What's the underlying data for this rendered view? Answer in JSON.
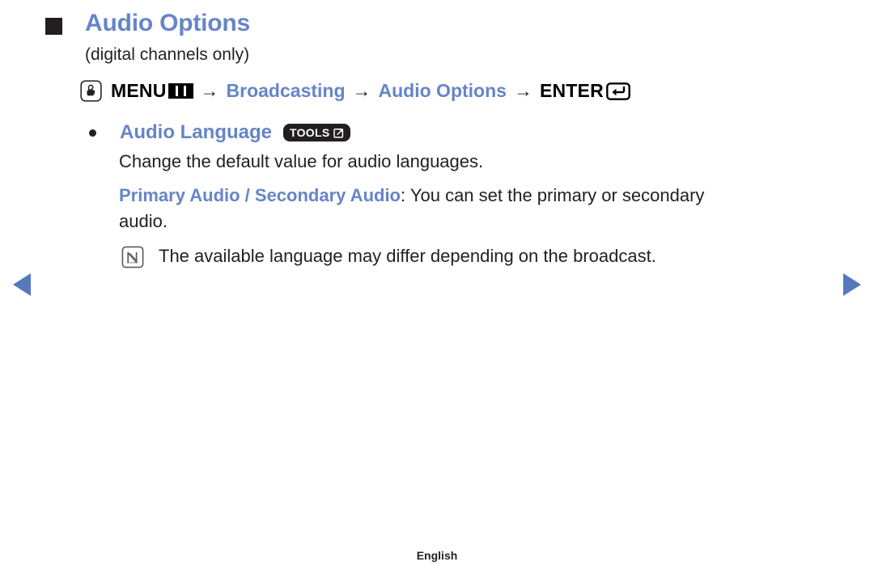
{
  "heading": {
    "bullet_icon": "filled-square-bullet",
    "title": "Audio Options",
    "subtitle": "(digital channels only)"
  },
  "menu_path": {
    "hand_icon": "hand-touch-icon",
    "menu_label": "MENU",
    "menu_glyph_icon": "menu-bars-icon",
    "arrow": "→",
    "step_broadcasting": "Broadcasting",
    "step_audio_options": "Audio Options",
    "enter_label": "ENTER",
    "enter_glyph_icon": "enter-return-key-icon"
  },
  "item": {
    "bullet_icon": "round-bullet",
    "label": "Audio Language",
    "badge_text": "TOOLS",
    "badge_icon": "tools-shortcut-icon",
    "description": "Change the default value for audio languages.",
    "option_name": "Primary Audio / Secondary Audio",
    "option_desc": ": You can set the primary or secondary",
    "option_desc_cont": "audio."
  },
  "note": {
    "icon": "note-pencil-icon",
    "text": "The available language may differ depending on the broadcast."
  },
  "navigation": {
    "prev_icon": "previous-page-arrow",
    "next_icon": "next-page-arrow"
  },
  "footer": {
    "language": "English"
  },
  "colors": {
    "accent_blue": "#6585c8",
    "nav_blue": "#5578bf",
    "text_black": "#231f20",
    "badge_bg": "#231f20",
    "background": "#ffffff"
  }
}
